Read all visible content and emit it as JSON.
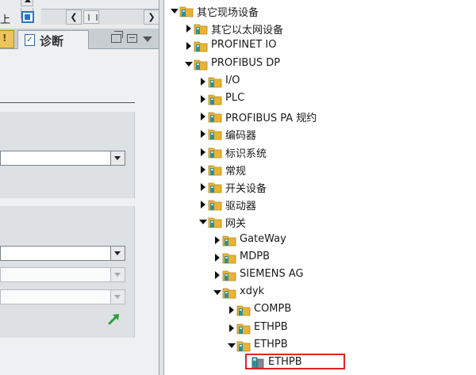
{
  "left_pane": {
    "clipped_char": "上",
    "tabs": {
      "edge_label": "!",
      "diag_label": "诊断"
    }
  },
  "tree": {
    "nodes": [
      {
        "label": "其它现场设备",
        "state": "open",
        "icon": "folder-icon",
        "level": 0
      },
      {
        "label": "其它以太网设备",
        "state": "closed",
        "icon": "folder-icon",
        "level": 1
      },
      {
        "label": "PROFINET IO",
        "state": "closed",
        "icon": "folder-icon",
        "level": 1
      },
      {
        "label": "PROFIBUS DP",
        "state": "open",
        "icon": "folder-icon",
        "level": 1
      },
      {
        "label": "I/O",
        "state": "closed",
        "icon": "folder-icon",
        "level": 2
      },
      {
        "label": "PLC",
        "state": "closed",
        "icon": "folder-icon",
        "level": 2
      },
      {
        "label": "PROFIBUS PA 规约",
        "state": "closed",
        "icon": "folder-icon",
        "level": 2
      },
      {
        "label": "编码器",
        "state": "closed",
        "icon": "folder-icon",
        "level": 2
      },
      {
        "label": "标识系统",
        "state": "closed",
        "icon": "folder-icon",
        "level": 2
      },
      {
        "label": "常规",
        "state": "closed",
        "icon": "folder-icon",
        "level": 2
      },
      {
        "label": "开关设备",
        "state": "closed",
        "icon": "folder-icon",
        "level": 2
      },
      {
        "label": "驱动器",
        "state": "closed",
        "icon": "folder-icon",
        "level": 2
      },
      {
        "label": "网关",
        "state": "open",
        "icon": "folder-icon",
        "level": 2
      },
      {
        "label": "GateWay",
        "state": "closed",
        "icon": "folder-icon",
        "level": 3
      },
      {
        "label": "MDPB",
        "state": "closed",
        "icon": "folder-icon",
        "level": 3
      },
      {
        "label": "SIEMENS AG",
        "state": "closed",
        "icon": "folder-icon",
        "level": 3
      },
      {
        "label": "xdyk",
        "state": "open",
        "icon": "folder-icon",
        "level": 3
      },
      {
        "label": "COMPB",
        "state": "closed",
        "icon": "folder-icon",
        "level": 4
      },
      {
        "label": "ETHPB",
        "state": "closed",
        "icon": "folder-icon",
        "level": 4
      },
      {
        "label": "ETHPB",
        "state": "open",
        "icon": "folder-icon",
        "level": 4
      },
      {
        "label": "ETHPB",
        "state": "leaf",
        "icon": "device-icon",
        "level": 5,
        "selected": true
      }
    ]
  },
  "colors": {
    "selection_border": "#e02323",
    "folder_yellow": "#e9b431",
    "folder_teal": "#2f8f99",
    "go_arrow": "#2e9e3a"
  }
}
